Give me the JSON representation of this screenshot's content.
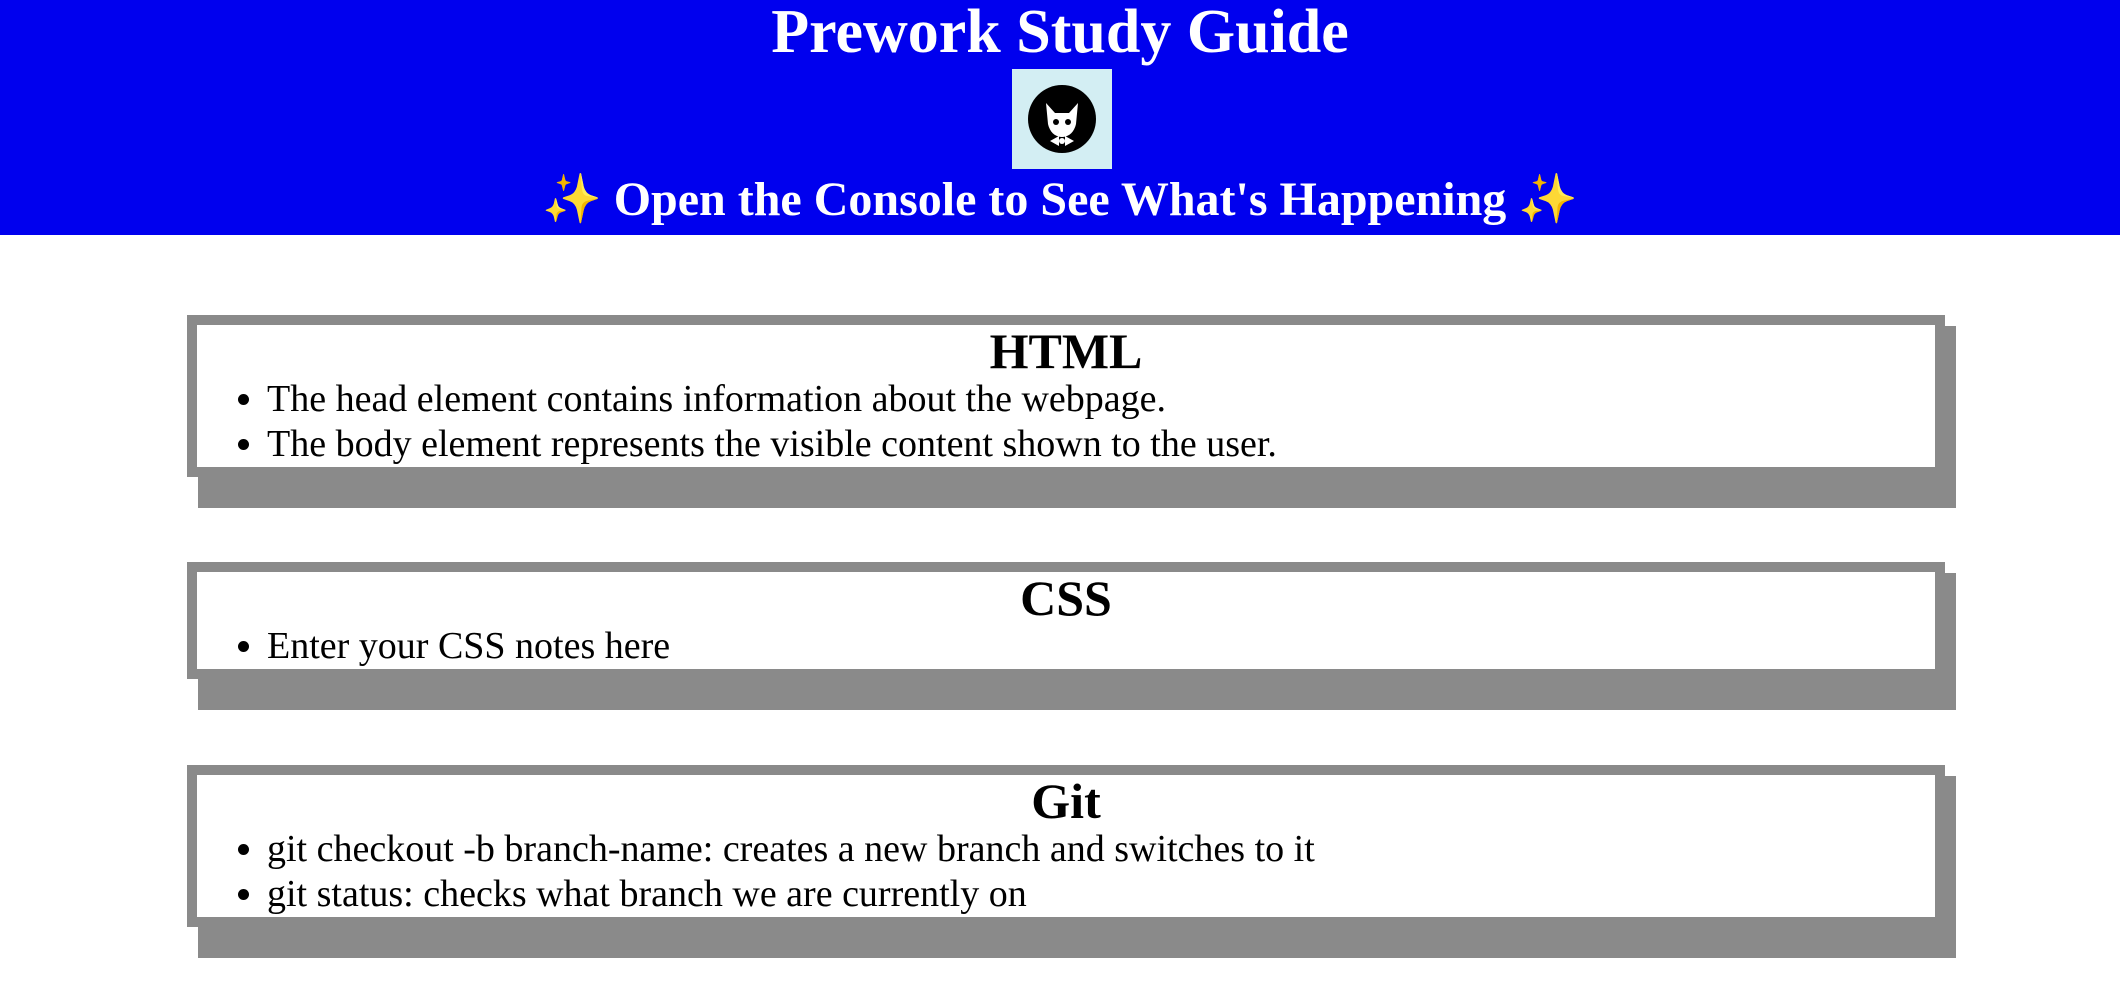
{
  "header": {
    "title": "Prework Study Guide",
    "subtitle_text": "Open the Console to See What's Happening",
    "sparkle_left": "✨",
    "sparkle_right": "✨",
    "logo_icon": "cat-logo-icon",
    "background_color": "#0000ee",
    "text_color": "#ffffff"
  },
  "sections": [
    {
      "title": "HTML",
      "items": [
        "The head element contains information about the webpage.",
        "The body element represents the visible content shown to the user."
      ]
    },
    {
      "title": "CSS",
      "items": [
        "Enter your CSS notes here"
      ]
    },
    {
      "title": "Git",
      "items": [
        "git checkout -b branch-name: creates a new branch and switches to it",
        "git status: checks what branch we are currently on"
      ]
    }
  ],
  "colors": {
    "card_border": "#8a8a8a",
    "card_shadow": "#8a8a8a",
    "logo_background": "#d3eef3"
  }
}
